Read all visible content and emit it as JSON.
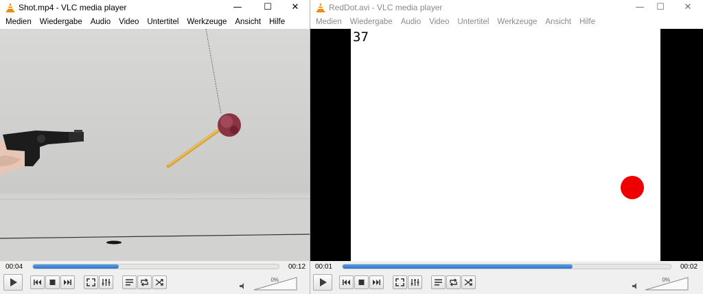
{
  "windows": [
    {
      "title": "Shot.mp4 - VLC media player",
      "active": true,
      "menu": [
        "Medien",
        "Wiedergabe",
        "Audio",
        "Video",
        "Untertitel",
        "Werkzeuge",
        "Ansicht",
        "Hilfe"
      ],
      "elapsed": "00:04",
      "total": "00:12",
      "progress": 0.35,
      "volume": "0%"
    },
    {
      "title": "RedDot.avi - VLC media player",
      "active": false,
      "menu": [
        "Medien",
        "Wiedergabe",
        "Audio",
        "Video",
        "Untertitel",
        "Werkzeuge",
        "Ansicht",
        "Hilfe"
      ],
      "elapsed": "00:01",
      "total": "00:02",
      "progress": 0.7,
      "volume": "0%",
      "frame_number": "37"
    }
  ],
  "window_controls": {
    "minimize": "—",
    "maximize": "☐",
    "close": "✕"
  },
  "colors": {
    "seek_fill": "#2d76cc",
    "red_dot": "#ee0000",
    "vlc_orange": "#f08a00"
  },
  "icons": [
    "vlc-cone-icon",
    "play-icon",
    "prev-icon",
    "stop-icon",
    "next-icon",
    "fullscreen-icon",
    "extended-settings-icon",
    "playlist-icon",
    "loop-icon",
    "shuffle-icon",
    "speaker-icon"
  ]
}
